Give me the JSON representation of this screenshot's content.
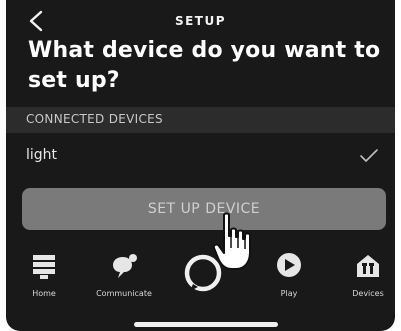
{
  "header": {
    "title": "SETUP",
    "back_icon": "chevron-left-icon"
  },
  "main": {
    "question": "What device do you want to set up?",
    "section_label": "CONNECTED DEVICES",
    "devices": [
      {
        "name": "light",
        "selected": true
      }
    ],
    "setup_button_label": "SET UP DEVICE"
  },
  "nav": {
    "items": [
      {
        "label": "Home",
        "icon": "home-icon"
      },
      {
        "label": "Communicate",
        "icon": "chat-icon"
      },
      {
        "label": "",
        "icon": "alexa-icon"
      },
      {
        "label": "Play",
        "icon": "play-icon"
      },
      {
        "label": "Devices",
        "icon": "devices-icon"
      }
    ]
  },
  "colors": {
    "background": "#191919",
    "section_bg": "#2c2c2c",
    "button_bg": "#7a7a7a"
  }
}
